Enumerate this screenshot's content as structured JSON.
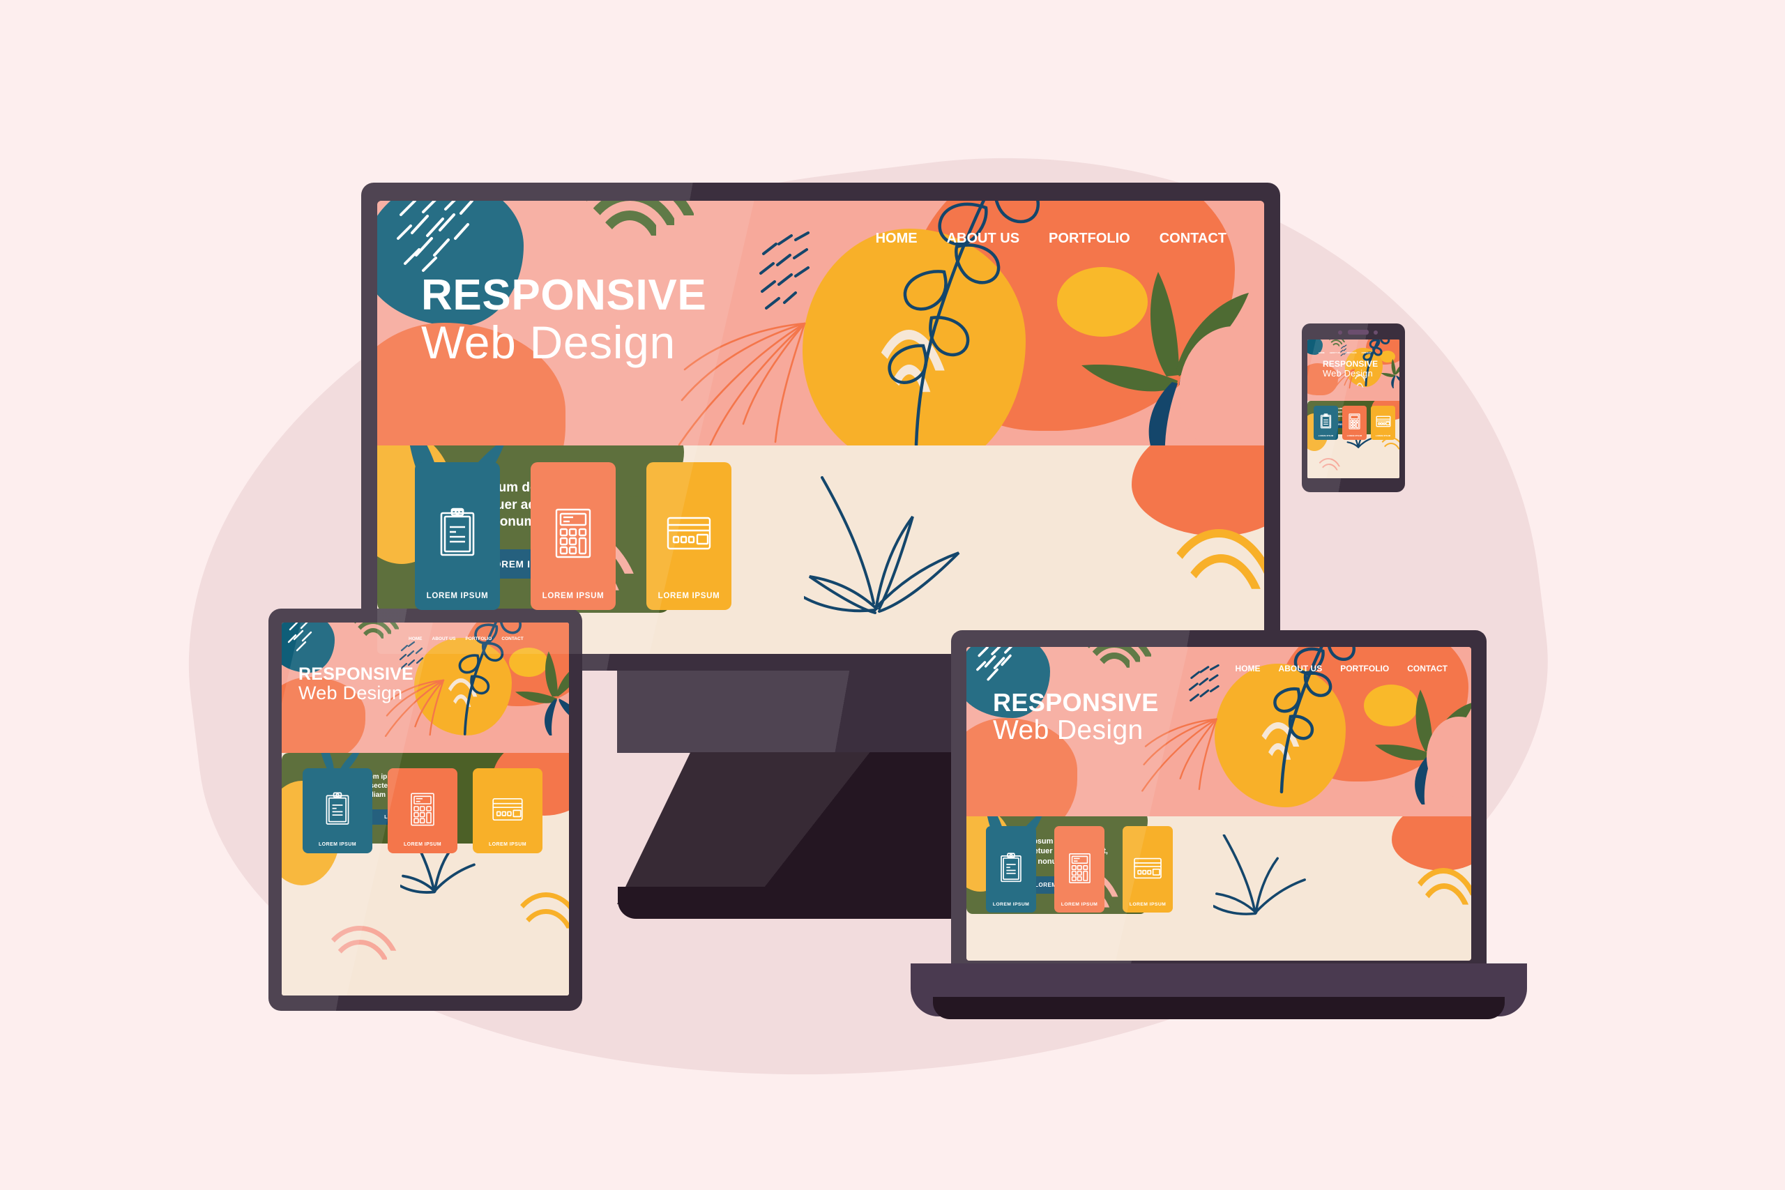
{
  "page": {
    "background_color": "#FDEEEE",
    "blob_color": "#F2DCDD"
  },
  "palette": {
    "bezel": "#3B2F3E",
    "bezel_dark": "#241622",
    "hero_pink": "#F7A99B",
    "cream": "#F6E7D7",
    "teal": "#0F5E78",
    "coral": "#F4764B",
    "yellow": "#F8B029",
    "green": "#4C6027",
    "olive": "#4E6B33",
    "button_blue": "#0D4E70",
    "white": "#FFFFFF"
  },
  "website": {
    "nav": [
      {
        "label": "HOME"
      },
      {
        "label": "ABOUT US"
      },
      {
        "label": "PORTFOLIO"
      },
      {
        "label": "CONTACT"
      }
    ],
    "hero": {
      "title_line1": "RESPONSIVE",
      "title_line2": "Web Design"
    },
    "cards": [
      {
        "icon": "clipboard-icon",
        "label": "LOREM IPSUM",
        "color": "#0F5E78"
      },
      {
        "icon": "calculator-icon",
        "label": "LOREM IPSUM",
        "color": "#F4764B"
      },
      {
        "icon": "credit-card-icon",
        "label": "LOREM IPSUM",
        "color": "#F8B029"
      }
    ],
    "cta": {
      "text": "Lorem ipsum dolor sit amet, consectetuer adipiscing elit, diam nonummy nibh.",
      "text_line1": "Lorem ipsum dolor sit amet,",
      "text_line2": "consectetuer adipiscing elit,",
      "text_line3": "diam nonummy nibh.",
      "button_label": "LOREM IPSUM"
    }
  },
  "devices": [
    {
      "name": "desktop-monitor",
      "type": "monitor"
    },
    {
      "name": "tablet",
      "type": "tablet"
    },
    {
      "name": "laptop",
      "type": "laptop"
    },
    {
      "name": "smartphone",
      "type": "phone"
    }
  ]
}
